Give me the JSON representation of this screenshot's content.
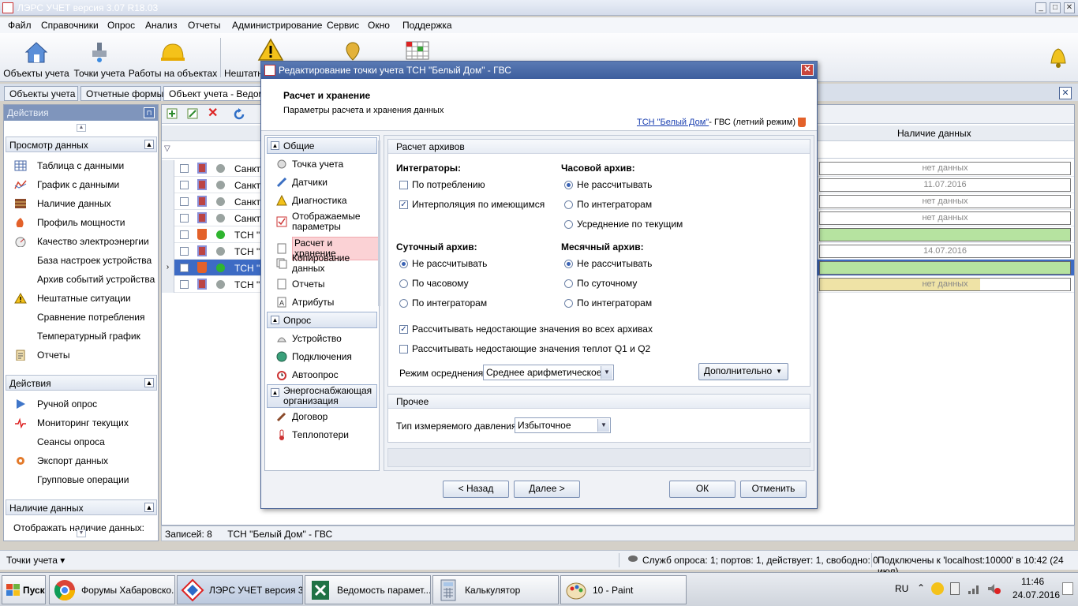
{
  "app": {
    "title": "ЛЭРС УЧЕТ версия 3.07 R18.03"
  },
  "menu": [
    "Файл",
    "Справочники",
    "Опрос",
    "Анализ",
    "Отчеты",
    "Администрирование",
    "Сервис",
    "Окно",
    "Поддержка"
  ],
  "toolbar": {
    "buttons": [
      "Объекты учета",
      "Точки учета",
      "Работы на объектах",
      "Нештатные"
    ]
  },
  "tabs": [
    "Объекты учета",
    "Отчетные формы",
    "Объект учета - Ведомо"
  ],
  "left_panel": {
    "header": "Действия",
    "sections": [
      {
        "title": "Просмотр данных",
        "items": [
          "Таблица с данными",
          "График с данными",
          "Наличие данных",
          "Профиль мощности",
          "Качество электроэнергии",
          "База настроек устройства",
          "Архив событий устройства",
          "Нештатные ситуации",
          "Сравнение потребления",
          "Температурный график",
          "Отчеты"
        ]
      },
      {
        "title": "Действия",
        "items": [
          "Ручной опрос",
          "Мониторинг текущих",
          "Сеансы опроса",
          "Экспорт данных",
          "Групповые операции"
        ]
      },
      {
        "title": "Наличие данных",
        "items": [
          "Отображать наличие данных:"
        ]
      }
    ]
  },
  "grid": {
    "column_header": "Наличие данных",
    "rows": [
      {
        "name": "Санкт-",
        "data": "нет данных",
        "status": "none"
      },
      {
        "name": "Санкт-",
        "data": "11.07.2016",
        "status": "none"
      },
      {
        "name": "Санкт-",
        "data": "нет данных",
        "status": "none"
      },
      {
        "name": "Санкт-",
        "data": "нет данных",
        "status": "none"
      },
      {
        "name": "ТСН \"Б",
        "data": "",
        "status": "green"
      },
      {
        "name": "ТСН \"Б",
        "data": "14.07.2016",
        "status": "none"
      },
      {
        "name": "ТСН \"Б",
        "data": "",
        "status": "green",
        "selected": true
      },
      {
        "name": "ТСН \"Б",
        "data": "нет данных",
        "status": "yellow"
      }
    ],
    "status": "Записей: 8",
    "status_obj": "ТСН \"Белый Дом\" - ГВС"
  },
  "bottom": {
    "left": "Точки учета",
    "services": "Служб опроса: 1; портов: 1, действует: 1, свободно: 0",
    "connection": "Подключены к 'localhost:10000' в 10:42 (24 июл)"
  },
  "dialog": {
    "title": "Редактирование точки учета ТСН \"Белый Дом\" - ГВС",
    "heading": "Расчет и хранение",
    "subheading": "Параметры расчета и хранения данных",
    "link": "ТСН \"Белый Дом\"",
    "link_suffix": " - ГВС (летний режим)",
    "nav": {
      "general": "Общие",
      "general_items": [
        "Точка учета",
        "Датчики",
        "Диагностика",
        "Отображаемые параметры",
        "Расчет и хранение",
        "Копирование данных",
        "Отчеты",
        "Атрибуты"
      ],
      "poll": "Опрос",
      "poll_items": [
        "Устройство",
        "Подключения",
        "Автоопрос"
      ],
      "supply": "Энергоснабжающая организация",
      "supply_items": [
        "Договор",
        "Теплопотери"
      ]
    },
    "archive_group": "Расчет архивов",
    "integrators": {
      "title": "Интеграторы:",
      "opt1": "По потреблению",
      "opt2": "Интерполяция по имеющимся"
    },
    "hourly": {
      "title": "Часовой архив:",
      "opts": [
        "Не рассчитывать",
        "По интеграторам",
        "Усреднение по текущим"
      ]
    },
    "daily": {
      "title": "Суточный архив:",
      "opts": [
        "Не рассчитывать",
        "По часовому",
        "По интеграторам"
      ]
    },
    "monthly": {
      "title": "Месячный архив:",
      "opts": [
        "Не рассчитывать",
        "По суточному",
        "По интеграторам"
      ]
    },
    "calc_missing_all": "Рассчитывать недостающие значения во всех архивах",
    "calc_missing_q": "Рассчитывать недостающие значения теплот Q1 и Q2",
    "avg_mode_label": "Режим осреднения:",
    "avg_mode_value": "Среднее арифметическое",
    "extra_button": "Дополнительно",
    "other_group": "Прочее",
    "pressure_label": "Тип измеряемого давления:",
    "pressure_value": "Избыточное",
    "buttons": {
      "back": "< Назад",
      "next": "Далее >",
      "ok": "ОК",
      "cancel": "Отменить"
    }
  },
  "taskbar": {
    "start": "Пуск",
    "tasks": [
      "Форумы Хабаровско...",
      "ЛЭРС УЧЕТ версия 3...",
      "Ведомость парамет...",
      "Калькулятор",
      "10 - Paint"
    ],
    "lang": "RU",
    "time": "11:46",
    "date": "24.07.2016"
  }
}
